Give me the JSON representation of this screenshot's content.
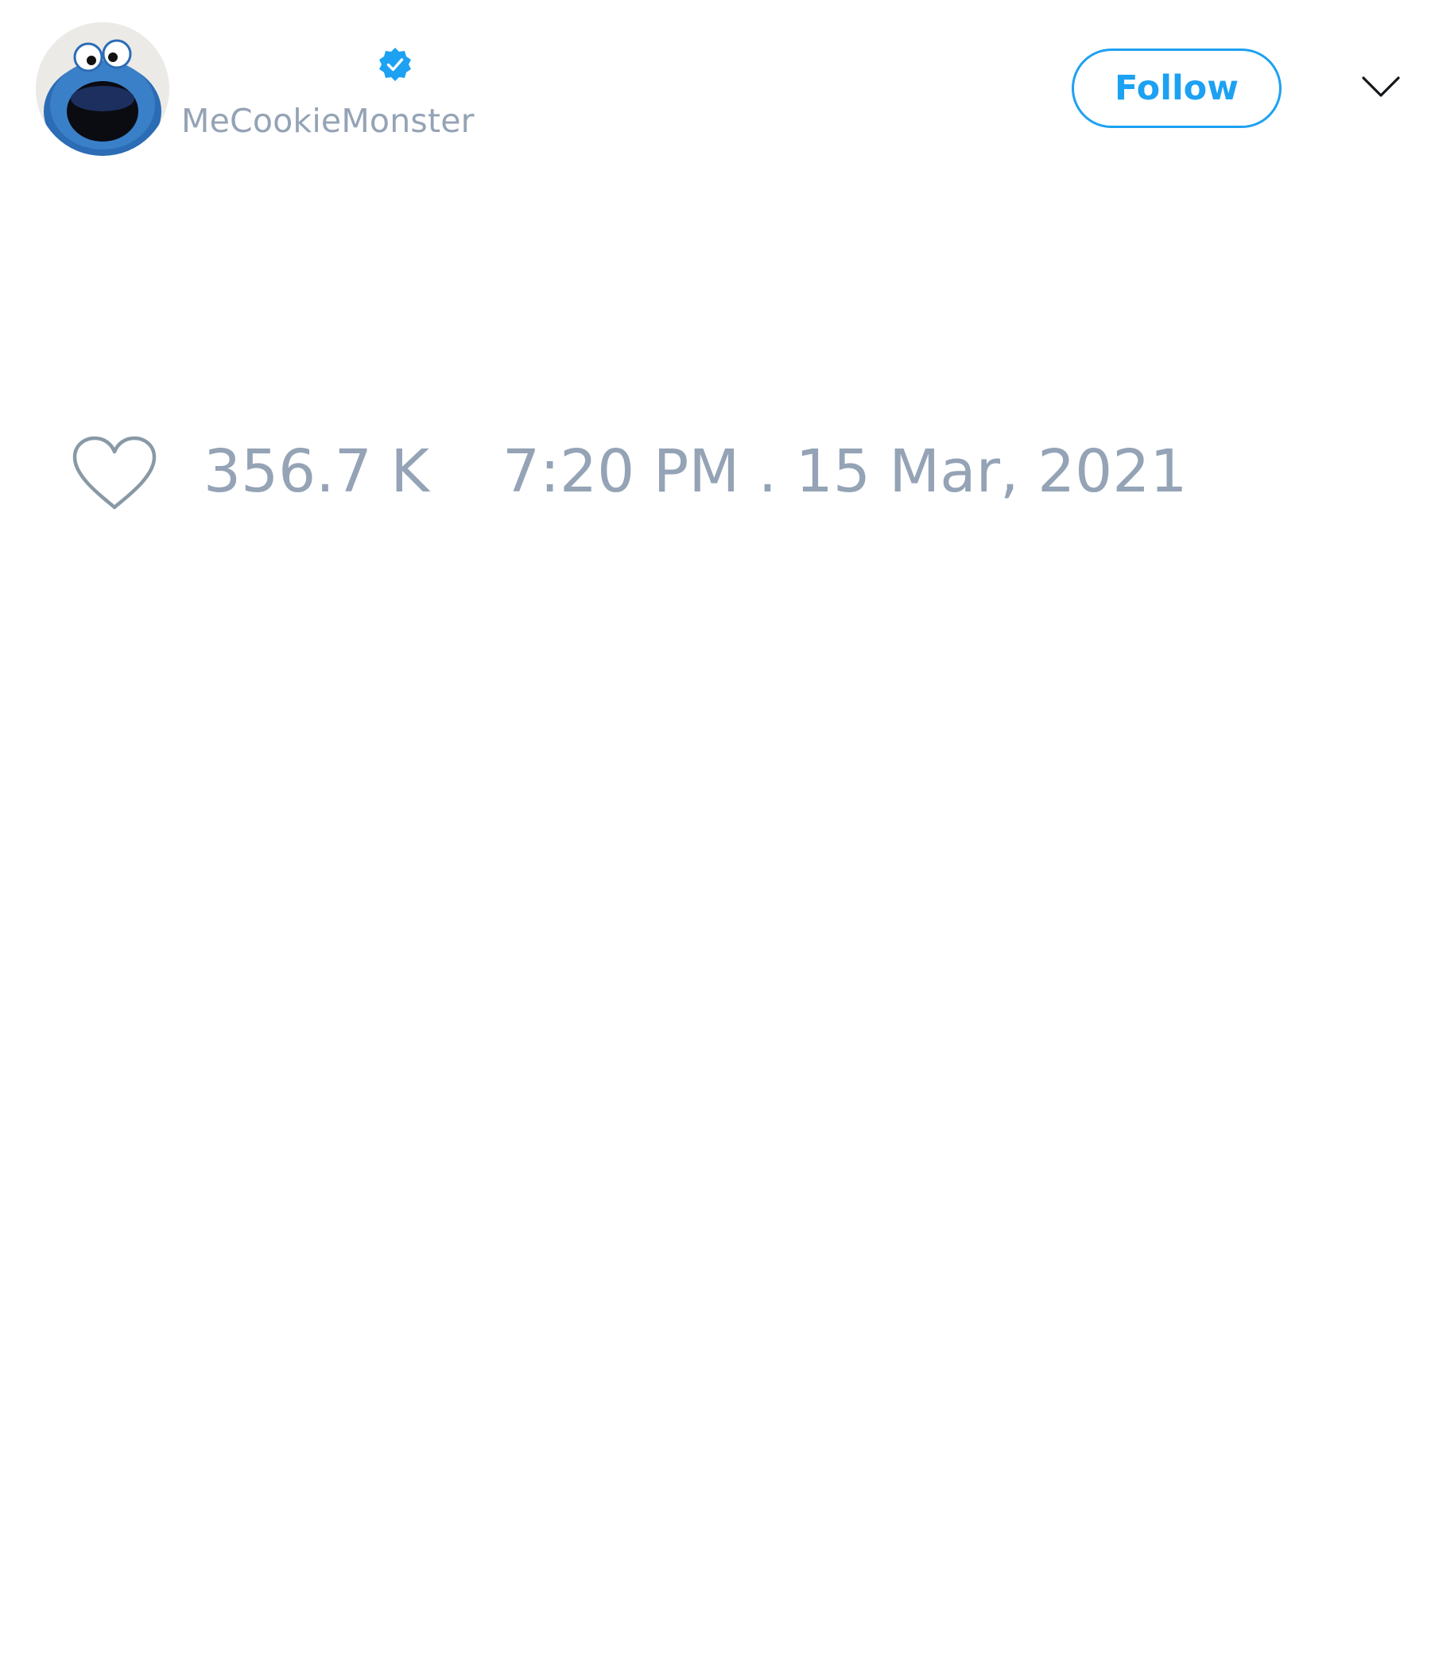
{
  "author": {
    "handle": "MeCookieMonster",
    "avatar_icon": "cookie-monster-avatar",
    "verified_icon": "verified-badge-icon"
  },
  "actions": {
    "follow_label": "Follow",
    "menu_icon": "chevron-down-icon"
  },
  "stats": {
    "like_icon": "heart-outline-icon",
    "likes": "356.7 K",
    "timestamp": "7:20 PM . 15 Mar, 2021"
  },
  "colors": {
    "accent": "#1da1f2",
    "muted_text": "#94a3b5",
    "background": "#ffffff"
  }
}
